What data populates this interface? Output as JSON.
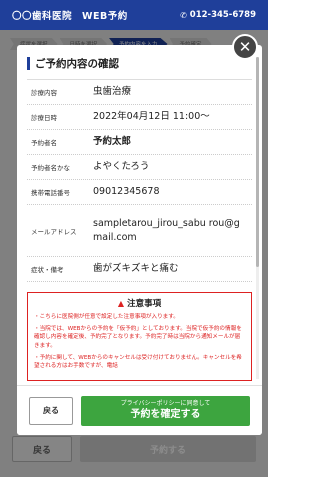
{
  "header": {
    "brand": "〇〇歯科医院　WEB予約",
    "phone": "012-345-6789",
    "phone_icon": "phone-icon"
  },
  "steps": [
    {
      "label": "症状を選択"
    },
    {
      "label": "日時を選択"
    },
    {
      "label": "予約内容を入力"
    },
    {
      "label": "予約確定"
    }
  ],
  "background_page": {
    "back_label": "戻る",
    "submit_label": "予約する"
  },
  "modal": {
    "title": "ご予約内容の確認",
    "close_icon": "close-icon",
    "rows": [
      {
        "label": "診療内容",
        "value": "虫歯治療"
      },
      {
        "label": "診療日時",
        "value": "2022年04月12日 11:00～"
      },
      {
        "label": "予約者名",
        "value": "予約太郎"
      },
      {
        "label": "予約者名かな",
        "value": "よやくたろう"
      },
      {
        "label": "携帯電話番号",
        "value": "09012345678"
      },
      {
        "label": "メールアドレス",
        "value": "sampletarou_jirou_sabu rou@gmail.com"
      },
      {
        "label": "症状・備考",
        "value": "歯がズキズキと痛む"
      }
    ],
    "notice": {
      "title": "注意事項",
      "icon": "warning-icon",
      "items": [
        "・こちらに医院側が任意で設定した注意事項が入ります。",
        "・当院では、WEBからの予約を「仮予約」としております。当院で仮予約の情報を確認し内容を確定後、予約完了となります。予約完了時は当院から通知メールが届きます。",
        "・予約に関して、WEBからのキャンセルは受け付けておりません。キャンセルを希望される方はお手数ですが、電話"
      ]
    },
    "scroll_position": 0.0,
    "footer": {
      "back_label": "戻る",
      "confirm_sub": "プライバシーポリシーに同意して",
      "confirm_main": "予約を確定する"
    }
  },
  "colors": {
    "header": "#1f3f9a",
    "confirm": "#3da53f",
    "notice": "#dd2222"
  }
}
